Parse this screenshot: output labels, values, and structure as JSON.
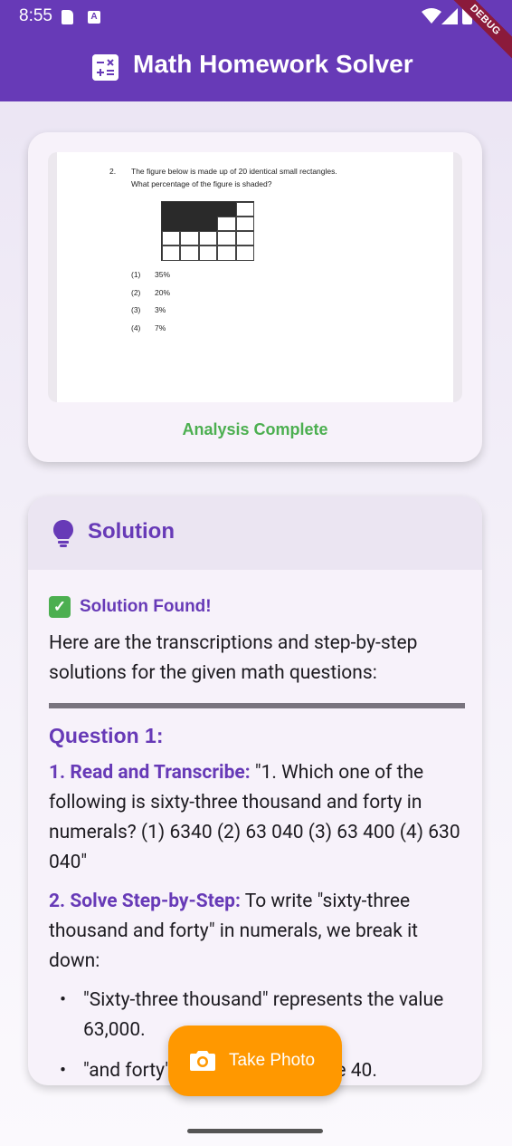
{
  "status_bar": {
    "time": "8:55",
    "icons": [
      "sd-card-icon",
      "a-notification-icon",
      "wifi-icon",
      "signal-icon",
      "battery-icon"
    ],
    "debug_banner": "DEBUG"
  },
  "app_bar": {
    "title": "Math Homework Solver",
    "icon": "calculator-icon",
    "color": "#673ab7"
  },
  "image_card": {
    "photo": {
      "question_number": "2.",
      "line1": "The figure below is made up of 20 identical small rectangles.",
      "line2": "What percentage of the figure is shaded?",
      "options": [
        {
          "num": "(1)",
          "text": "35%"
        },
        {
          "num": "(2)",
          "text": "20%"
        },
        {
          "num": "(3)",
          "text": "3%"
        },
        {
          "num": "(4)",
          "text": "7%"
        }
      ]
    },
    "status": "Analysis Complete",
    "status_color": "#4caf50"
  },
  "solution": {
    "header_title": "Solution",
    "header_icon": "lightbulb-icon",
    "found_text": "Solution Found!",
    "intro": "Here are the transcriptions and step-by-step solutions for the given math questions:",
    "question_title": "Question 1:",
    "step1_label": "1. Read and Transcribe:",
    "step1_text": " \"1. Which one of the following is sixty-three thousand and forty in numerals? (1) 6340 (2) 63 040 (3) 63 400 (4) 630 040\"",
    "step2_label": "2. Solve Step-by-Step:",
    "step2_text": " To write \"sixty-three thousand and forty\" in numerals, we break it down:",
    "bullets": [
      "\"Sixty-three thousand\" represents the value 63,000.",
      "\"and forty\" represents the value 40."
    ]
  },
  "fab": {
    "label": "Take Photo",
    "icon": "camera-icon",
    "color": "#ff9800"
  }
}
